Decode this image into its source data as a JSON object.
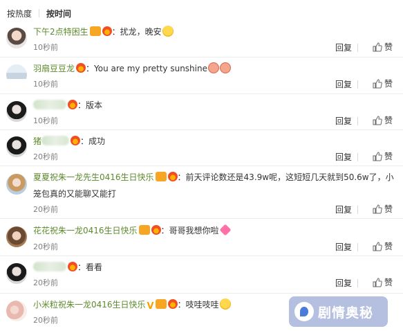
{
  "tabs": [
    {
      "label": "按热度",
      "active": false
    },
    {
      "label": "按时间",
      "active": true
    }
  ],
  "actions": {
    "reply_label": "回复",
    "like_label": "赞"
  },
  "comments": [
    {
      "username": "下午2点特困生",
      "text": "：扰龙，晚安",
      "time": "10秒前"
    },
    {
      "username": "羽扇豆豆龙",
      "text": "：You are my pretty sunshine",
      "time": "10秒前"
    },
    {
      "username": "",
      "text": "：版本",
      "time": "10秒前"
    },
    {
      "username": "猪",
      "text": "：成功",
      "time": "20秒前"
    },
    {
      "username": "夏夏祝朱一龙先生0416生日快乐",
      "text": "：前天评论数还是43.9w呢，这短短几天就到50.6w了，小",
      "text2": "笼包真的又能聊又能打",
      "time": "20秒前"
    },
    {
      "username": "花花祝朱一龙0416生日快乐",
      "text": "：哥哥我想你啦",
      "time": "20秒前"
    },
    {
      "username": "",
      "text": "：看看",
      "time": "20秒前"
    },
    {
      "username": "小米粒祝朱一龙0416生日快乐",
      "text": "：吱哇吱哇",
      "time": "20秒前"
    }
  ],
  "watermark": {
    "text": "剧情奥秘"
  },
  "colors": {
    "username": "#5c8a2c",
    "meta": "#808080",
    "accent": "#eb7350"
  }
}
